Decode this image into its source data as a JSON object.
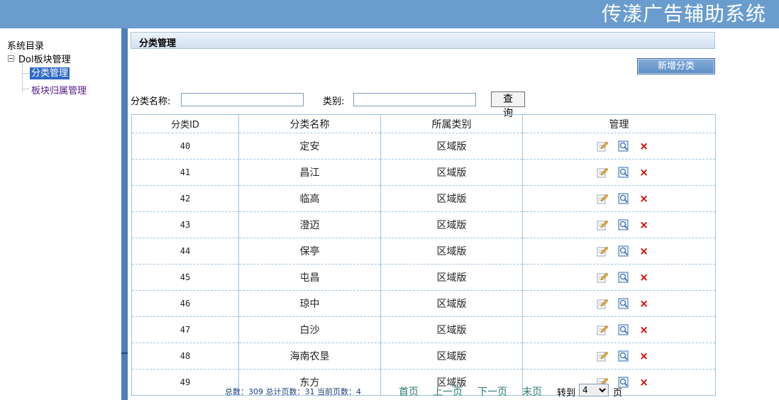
{
  "app": {
    "system_title": "传漾广告辅助系统"
  },
  "sidebar": {
    "root_label": "系统目录",
    "node_label": "Dol板块管理",
    "children": [
      "分类管理",
      "板块归属管理"
    ]
  },
  "page": {
    "title": "分类管理",
    "add_button": "新增分类"
  },
  "search": {
    "name_label": "分类名称:",
    "name_value": "",
    "type_label": "类别:",
    "type_value": "",
    "query_button": "查 询"
  },
  "table": {
    "headers": [
      "分类ID",
      "分类名称",
      "所属类别",
      "管理"
    ],
    "rows": [
      {
        "id": "40",
        "name": "定安",
        "type": "区域版"
      },
      {
        "id": "41",
        "name": "昌江",
        "type": "区域版"
      },
      {
        "id": "42",
        "name": "临高",
        "type": "区域版"
      },
      {
        "id": "43",
        "name": "澄迈",
        "type": "区域版"
      },
      {
        "id": "44",
        "name": "保亭",
        "type": "区域版"
      },
      {
        "id": "45",
        "name": "屯昌",
        "type": "区域版"
      },
      {
        "id": "46",
        "name": "琼中",
        "type": "区域版"
      },
      {
        "id": "47",
        "name": "白沙",
        "type": "区域版"
      },
      {
        "id": "48",
        "name": "海南农垦",
        "type": "区域版"
      },
      {
        "id": "49",
        "name": "东方",
        "type": "区域版"
      }
    ],
    "action_icons": [
      "edit-icon",
      "view-icon",
      "delete-icon"
    ],
    "delete_glyph": "×"
  },
  "pager": {
    "stats": "总数：309  总计页数：31 当前页数：4",
    "first": "首页",
    "prev": "上一页",
    "next": "下一页",
    "last": "末页",
    "goto_label": "转到",
    "current_page": "4",
    "page_suffix": "页"
  },
  "colors": {
    "topbar": "#6a9cce",
    "divider": "#4d7fb8",
    "grid_border": "#9fc3e0",
    "delete": "#d40000",
    "pager_link": "#2b7a6e"
  }
}
